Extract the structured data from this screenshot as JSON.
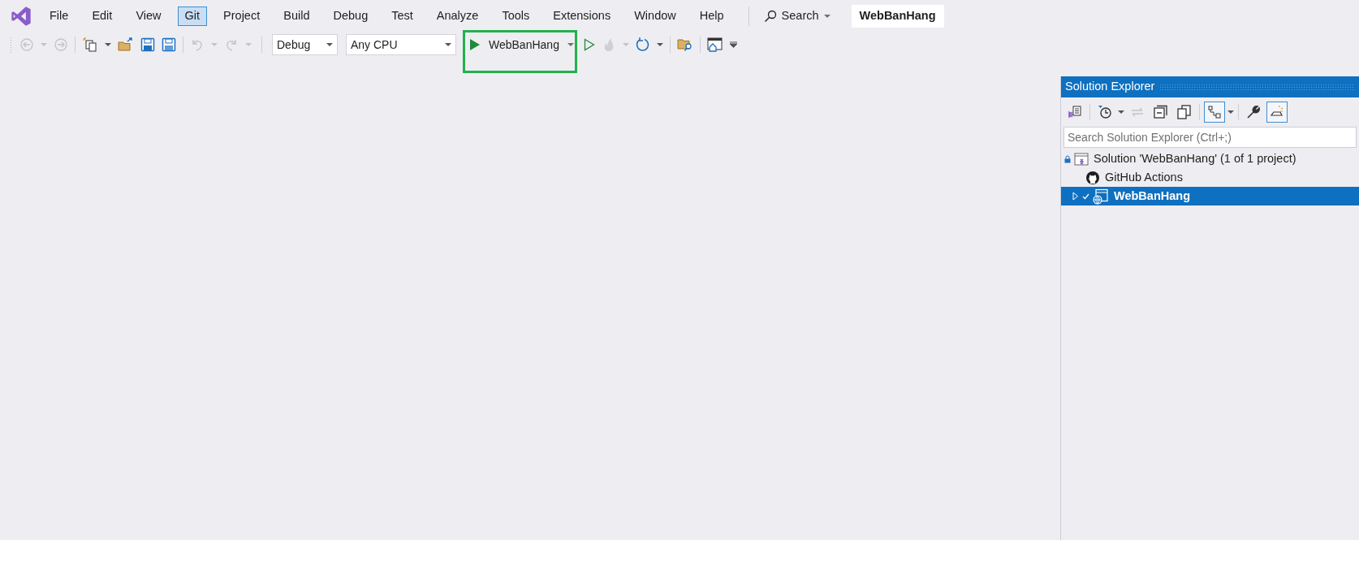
{
  "menu": [
    {
      "label": "File",
      "selected": false
    },
    {
      "label": "Edit",
      "selected": false
    },
    {
      "label": "View",
      "selected": false
    },
    {
      "label": "Git",
      "selected": true
    },
    {
      "label": "Project",
      "selected": false
    },
    {
      "label": "Build",
      "selected": false
    },
    {
      "label": "Debug",
      "selected": false
    },
    {
      "label": "Test",
      "selected": false
    },
    {
      "label": "Analyze",
      "selected": false
    },
    {
      "label": "Tools",
      "selected": false
    },
    {
      "label": "Extensions",
      "selected": false
    },
    {
      "label": "Window",
      "selected": false
    },
    {
      "label": "Help",
      "selected": false
    }
  ],
  "search": {
    "label": "Search"
  },
  "solution_name": "WebBanHang",
  "toolbar": {
    "configuration": "Debug",
    "platform": "Any CPU",
    "run_target": {
      "label": "WebBanHang",
      "highlighted": true
    }
  },
  "solution_explorer": {
    "title": "Solution Explorer",
    "toolbar_buttons": [
      {
        "kind": "switch-views",
        "pressed": false
      },
      {
        "kind": "history",
        "pressed": false
      },
      {
        "kind": "sync",
        "pressed": false
      },
      {
        "kind": "collapse",
        "pressed": false
      },
      {
        "kind": "copies",
        "pressed": false
      },
      {
        "kind": "tree",
        "pressed": true
      },
      {
        "kind": "properties",
        "pressed": false
      },
      {
        "kind": "preview",
        "pressed": true
      }
    ],
    "search": {
      "placeholder": "Search Solution Explorer (Ctrl+;)"
    },
    "tree": [
      {
        "label": "Solution 'WebBanHang' (1 of 1 project)",
        "kind": "solution",
        "selected": false,
        "children": [
          {
            "label": "GitHub Actions",
            "kind": "github",
            "selected": false
          },
          {
            "label": "WebBanHang",
            "kind": "project",
            "selected": true,
            "expanded": false
          }
        ]
      }
    ]
  }
}
